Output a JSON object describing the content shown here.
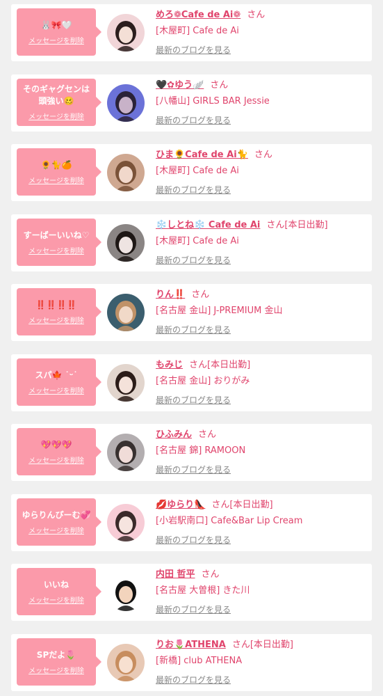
{
  "colors": {
    "accent": "#e0446c",
    "bubble": "#fb9aaa",
    "card": "#ffffff",
    "background": "#f0f0f0",
    "muted": "#888888"
  },
  "items": [
    {
      "message": "🐰🎀🤍",
      "delete_label": "メッセージを削除",
      "name": "めろ❁Cafe de Ai❁",
      "honorific": "さん",
      "status": "",
      "shop": "[木屋町] Cafe de Ai",
      "blog_link": "最新のブログを見る",
      "avatar": {
        "bg": "#f1d5d8",
        "hair": "#2b1d1d",
        "skin": "#f4dfd6"
      }
    },
    {
      "message": "そのギャグセンは頭強い🥴",
      "delete_label": "メッセージを削除",
      "name": "🖤✿ゆう🪽",
      "honorific": "さん",
      "status": "",
      "shop": "[八幡山] GIRLS BAR Jessie",
      "blog_link": "最新のブログを見る",
      "avatar": {
        "bg": "#6b72d8",
        "hair": "#2a2238",
        "skin": "#c8b2c8"
      }
    },
    {
      "message": "🌻🐈🍊",
      "delete_label": "メッセージを削除",
      "name": "ひま🌻Cafe de Ai🐈",
      "honorific": "さん",
      "status": "",
      "shop": "[木屋町] Cafe de Ai",
      "blog_link": "最新のブログを見る",
      "avatar": {
        "bg": "#cfa891",
        "hair": "#7a5238",
        "skin": "#f1d8cb"
      }
    },
    {
      "message": "すーばーいいね♡",
      "delete_label": "メッセージを削除",
      "name": "❄️しとね❄️ Cafe de Ai",
      "honorific": "さん",
      "status": "[本日出勤]",
      "shop": "[木屋町] Cafe de Ai",
      "blog_link": "最新のブログを見る",
      "avatar": {
        "bg": "#8a8584",
        "hair": "#1d1715",
        "skin": "#eee4e2"
      }
    },
    {
      "message": "‼️‼️‼️‼️",
      "delete_label": "メッセージを削除",
      "name": "りん‼️",
      "honorific": "さん",
      "status": "",
      "shop": "[名古屋 金山] J-PREMIUM 金山",
      "blog_link": "最新のブログを見る",
      "avatar": {
        "bg": "#3b5e6e",
        "hair": "#c09268",
        "skin": "#f1d9c8"
      }
    },
    {
      "message": "スパ🍁 ˙ᵕ˙",
      "delete_label": "メッセージを削除",
      "name": "もみじ",
      "honorific": "さん",
      "status": "[本日出勤]",
      "shop": "[名古屋 金山] おりがみ",
      "blog_link": "最新のブログを見る",
      "avatar": {
        "bg": "#e2d5cd",
        "hair": "#2b1c18",
        "skin": "#f4e2da"
      }
    },
    {
      "message": "💖💖💖",
      "delete_label": "メッセージを削除",
      "name": "ひふみん",
      "honorific": "さん",
      "status": "",
      "shop": "[名古屋 錦] RAMOON",
      "blog_link": "最新のブログを見る",
      "avatar": {
        "bg": "#b3aeb0",
        "hair": "#37302f",
        "skin": "#f0dcd8"
      }
    },
    {
      "message": "ゆらりんぴーむ💞",
      "delete_label": "メッセージを削除",
      "name": "💋ゆらり👠",
      "honorific": "さん",
      "status": "[本日出勤]",
      "shop": "[小岩駅南口] Cafe&Bar Lip Cream",
      "blog_link": "最新のブログを見る",
      "avatar": {
        "bg": "#f7ccd6",
        "hair": "#3a2a2a",
        "skin": "#f6e4df"
      }
    },
    {
      "message": "いいね",
      "delete_label": "メッセージを削除",
      "name": "内田 哲平",
      "honorific": "さん",
      "status": "",
      "shop": "[名古屋 大曽根] きた川",
      "blog_link": "最新のブログを見る",
      "avatar": {
        "bg": "#ffffff",
        "hair": "#111111",
        "skin": "#f3d4bd"
      }
    },
    {
      "message": "SPだよ🌷",
      "delete_label": "メッセージを削除",
      "name": "りお🌷ATHENA",
      "honorific": "さん",
      "status": "[本日出勤]",
      "shop": "[新橋] club ATHENA",
      "blog_link": "最新のブログを見る",
      "avatar": {
        "bg": "#e8c9b5",
        "hair": "#c78d5e",
        "skin": "#f7e0d0"
      }
    }
  ]
}
